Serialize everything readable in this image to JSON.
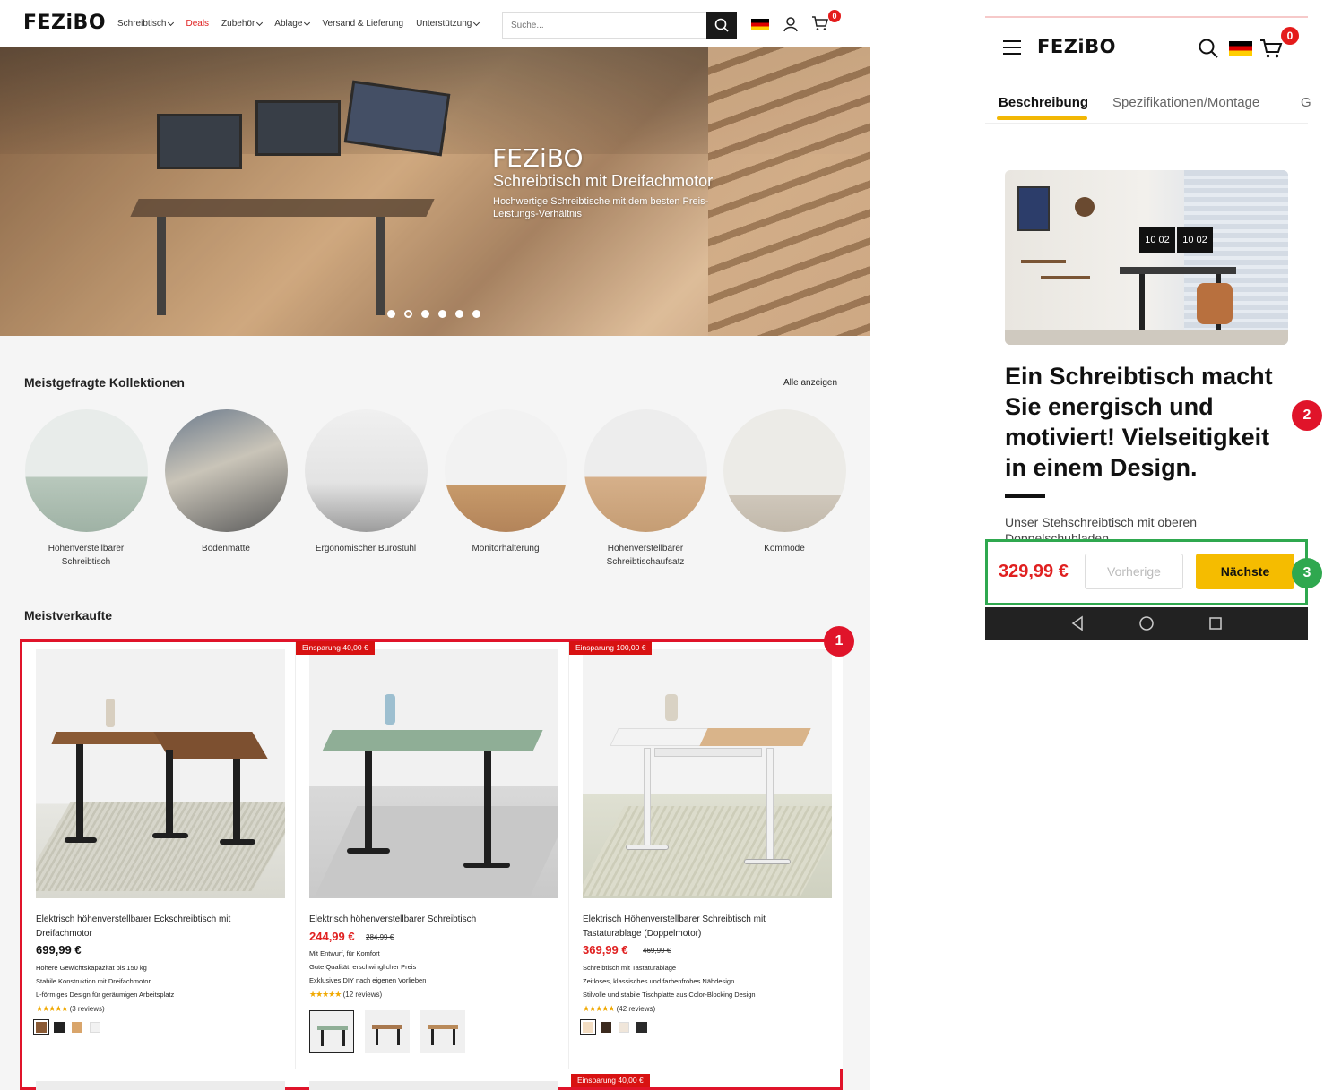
{
  "desktop": {
    "logo": "FEZiBO",
    "menu": [
      {
        "label": "Schreibtisch",
        "chevron": true,
        "highlight": false
      },
      {
        "label": "Deals",
        "chevron": false,
        "highlight": true
      },
      {
        "label": "Zubehör",
        "chevron": true,
        "highlight": false
      },
      {
        "label": "Ablage",
        "chevron": true,
        "highlight": false
      },
      {
        "label": "Versand & Lieferung",
        "chevron": false,
        "highlight": false
      },
      {
        "label": "Unterstützung",
        "chevron": true,
        "highlight": false
      }
    ],
    "search_placeholder": "Suche...",
    "cart_count": "0",
    "hero": {
      "brand": "FEZiBO",
      "title": "Schreibtisch mit Dreifachmotor",
      "subtitle": "Hochwertige Schreibtische mit dem besten Preis-Leistungs-Verhältnis",
      "slide_count": 6,
      "active_slide": 2
    },
    "collections": {
      "title": "Meistgefragte Kollektionen",
      "view_all": "Alle anzeigen",
      "items": [
        {
          "label": "Höhenverstellbarer Schreibtisch"
        },
        {
          "label": "Bodenmatte"
        },
        {
          "label": "Ergonomischer Bürostühl"
        },
        {
          "label": "Monitorhalterung"
        },
        {
          "label": "Höhenverstellbarer Schreibtischaufsatz"
        },
        {
          "label": "Kommode"
        }
      ]
    },
    "bestsellers": {
      "title": "Meistverkaufte",
      "products": [
        {
          "name": "Elektrisch höhenverstellbarer Eckschreibtisch mit Dreifachmotor",
          "price": "699,99 €",
          "old_price": "",
          "saving": "",
          "features": [
            "Höhere Gewichtskapazität bis 150 kg",
            "Stabile Konstruktion mit Dreifachmotor",
            "L-förmiges Design für geräumigen Arbeitsplatz"
          ],
          "stars": "★★★★★",
          "reviews": "(3 reviews)",
          "swatches": [
            "#8a5a35",
            "#222222",
            "#d9a56b",
            "#f2f2f2"
          ]
        },
        {
          "name": "Elektrisch höhenverstellbarer Schreibtisch",
          "price": "244,99 €",
          "old_price": "284,99 €",
          "saving": "Einsparung 40,00 €",
          "features": [
            "Mit Entwurf, für Komfort",
            "Gute Qualität, erschwinglicher Preis",
            "Exklusives DIY nach eigenen Vorlieben"
          ],
          "stars": "★★★★★",
          "reviews": "(12 reviews)",
          "thumb_colors": [
            "#8fae96",
            "#a8784e",
            "#b98a5a"
          ]
        },
        {
          "name": "Elektrisch Höhenverstellbarer Schreibtisch mit Tastaturablage (Doppelmotor)",
          "price": "369,99 €",
          "old_price": "469,99 €",
          "saving": "Einsparung 100,00 €",
          "features": [
            "Schreibtisch mit Tastaturablage",
            "Zeitloses, klassisches und farbenfrohes Nähdesign",
            "Stilvolle und stabile Tischplatte aus Color-Blocking Design"
          ],
          "stars": "★★★★★",
          "reviews": "(42 reviews)",
          "swatches": [
            "#f3ddc2",
            "#3b2a1e",
            "#f0e6da",
            "#2a2a2a"
          ]
        }
      ],
      "next_row_saving": "Einsparung 40,00 €"
    }
  },
  "mobile": {
    "logo": "FEZiBO",
    "cart_count": "0",
    "tabs": [
      "Beschreibung",
      "Spezifikationen/Montage",
      "G"
    ],
    "heading": "Ein Schreibtisch macht Sie energisch und motiviert! Vielseitigkeit in einem Design.",
    "description": "Unser Stehschreibtisch mit oberen Doppelschubladen...",
    "image_clock": "10 02",
    "price": "329,99 €",
    "prev_label": "Vorherige",
    "next_label": "Nächste"
  },
  "markers": [
    {
      "label": "1",
      "color": "#e0142a"
    },
    {
      "label": "2",
      "color": "#e0142a"
    },
    {
      "label": "3",
      "color": "#2fa84f"
    }
  ]
}
